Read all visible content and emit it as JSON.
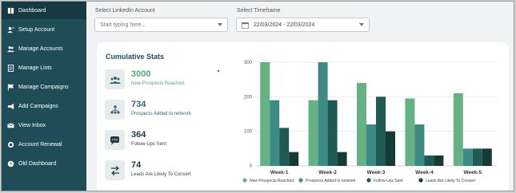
{
  "sidebar": {
    "items": [
      {
        "label": "Dashboard",
        "icon": "dashboard-icon",
        "active": true
      },
      {
        "label": "Setup Account",
        "icon": "user-plus-icon"
      },
      {
        "label": "Manage Accounts",
        "icon": "users-icon"
      },
      {
        "label": "Manage Lists",
        "icon": "list-icon"
      },
      {
        "label": "Manage Campaigns",
        "icon": "flag-icon"
      },
      {
        "label": "Add Campaigns",
        "icon": "megaphone-icon"
      },
      {
        "label": "View Inbox",
        "icon": "inbox-icon"
      },
      {
        "label": "Account Renewal",
        "icon": "renewal-icon"
      },
      {
        "label": "Old Dashboard",
        "icon": "clock-icon"
      }
    ]
  },
  "filters": {
    "account_label": "Select LinkedIn Account",
    "account_placeholder": "Start typing here...",
    "timeframe_label": "Select Timeframe",
    "timeframe_value": "22/03/2024 - 22/03/2024"
  },
  "stats": {
    "title": "Cumulative Stats",
    "items": [
      {
        "value": "3000",
        "label": "New Prospects Reached.",
        "color": "#5aa67a",
        "icon": "group-icon"
      },
      {
        "value": "734",
        "label": "Prospects Added to network",
        "color": "#2f6a75",
        "icon": "network-icon"
      },
      {
        "value": "364",
        "label": "Follow-Ups Sent",
        "color": "#1f3d42",
        "icon": "chat-icon"
      },
      {
        "value": "74",
        "label": "Leads Are Likely To Convert",
        "color": "#1f3d42",
        "icon": "exchange-icon"
      }
    ]
  },
  "chart_data": {
    "type": "bar",
    "categories": [
      "Week-1",
      "Week-2",
      "Week-3",
      "Week-4",
      "Week-5"
    ],
    "series": [
      {
        "name": "New Prospects Reached.",
        "color": "#67b285",
        "values": [
          300,
          190,
          240,
          195,
          210
        ]
      },
      {
        "name": "Prospects Added to network",
        "color": "#3e8b86",
        "values": [
          190,
          300,
          120,
          120,
          50
        ]
      },
      {
        "name": "Follow-Ups Sent",
        "color": "#1f5a55",
        "values": [
          110,
          190,
          200,
          30,
          50
        ]
      },
      {
        "name": "Leads Are Likely To Convert",
        "color": "#163a36",
        "values": [
          40,
          40,
          100,
          30,
          50
        ]
      }
    ],
    "yticks": [
      0,
      100,
      200,
      300
    ],
    "ylim": [
      0,
      300
    ],
    "legend": "bottom",
    "grid": true
  }
}
